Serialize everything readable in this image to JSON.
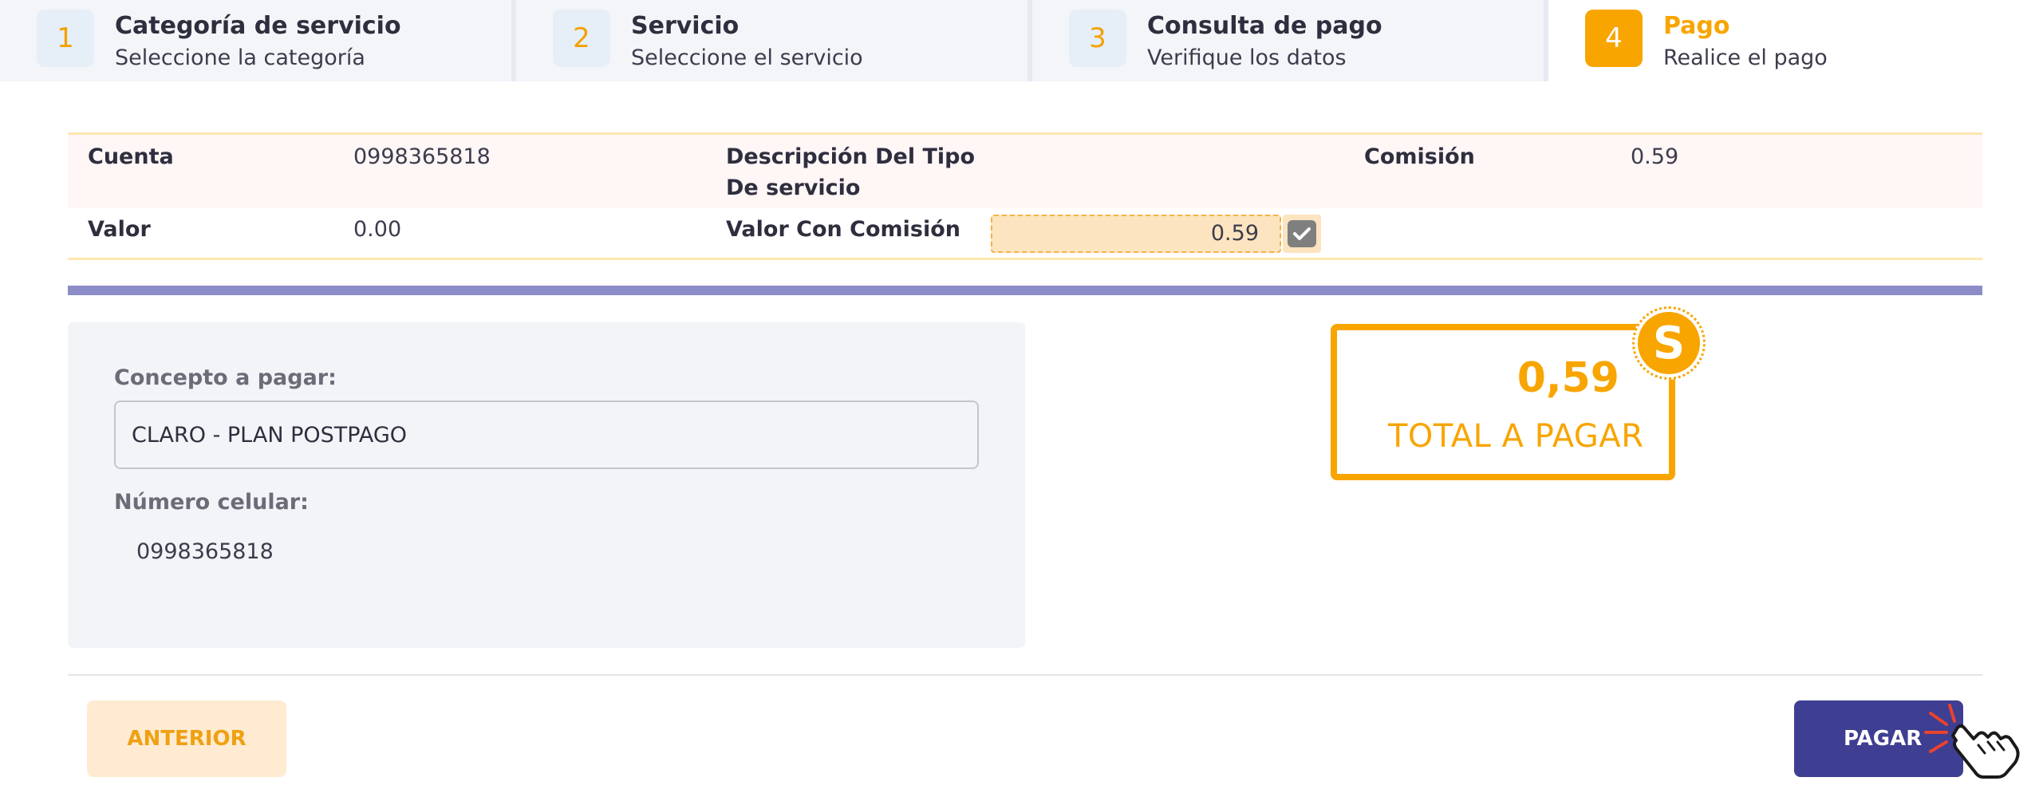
{
  "stepper": {
    "steps": [
      {
        "number": "1",
        "title": "Categoría de servicio",
        "subtitle": "Seleccione la categoría"
      },
      {
        "number": "2",
        "title": "Servicio",
        "subtitle": "Seleccione el servicio"
      },
      {
        "number": "3",
        "title": "Consulta de pago",
        "subtitle": "Verifique los datos"
      },
      {
        "number": "4",
        "title": "Pago",
        "subtitle": "Realice el pago"
      }
    ],
    "active_step": 4
  },
  "details": {
    "cuenta_label": "Cuenta",
    "cuenta_value": "0998365818",
    "descripcion_label_line1": "Descripción Del Tipo",
    "descripcion_label_line2": "De servicio",
    "comision_label": "Comisión",
    "comision_value": "0.59",
    "valor_label": "Valor",
    "valor_value": "0.00",
    "valor_comision_label": "Valor Con Comisión",
    "valor_comision_value": "0.59"
  },
  "concept_panel": {
    "concepto_label": "Concepto a pagar:",
    "concepto_value": "CLARO - PLAN POSTPAGO",
    "celular_label": "Número celular:",
    "celular_value": "0998365818"
  },
  "total": {
    "amount": "0,59",
    "label": "TOTAL A PAGAR",
    "coin_symbol": "S"
  },
  "actions": {
    "prev_label": "ANTERIOR",
    "pay_label": "PAGAR"
  },
  "icons": {
    "check": "check-icon",
    "coin": "dollar-coin-icon",
    "pointer": "hand-pointer-icon"
  },
  "colors": {
    "accent": "#f8a500",
    "primary_button": "#3e3e92",
    "purple_divider": "#8c8cc8"
  }
}
